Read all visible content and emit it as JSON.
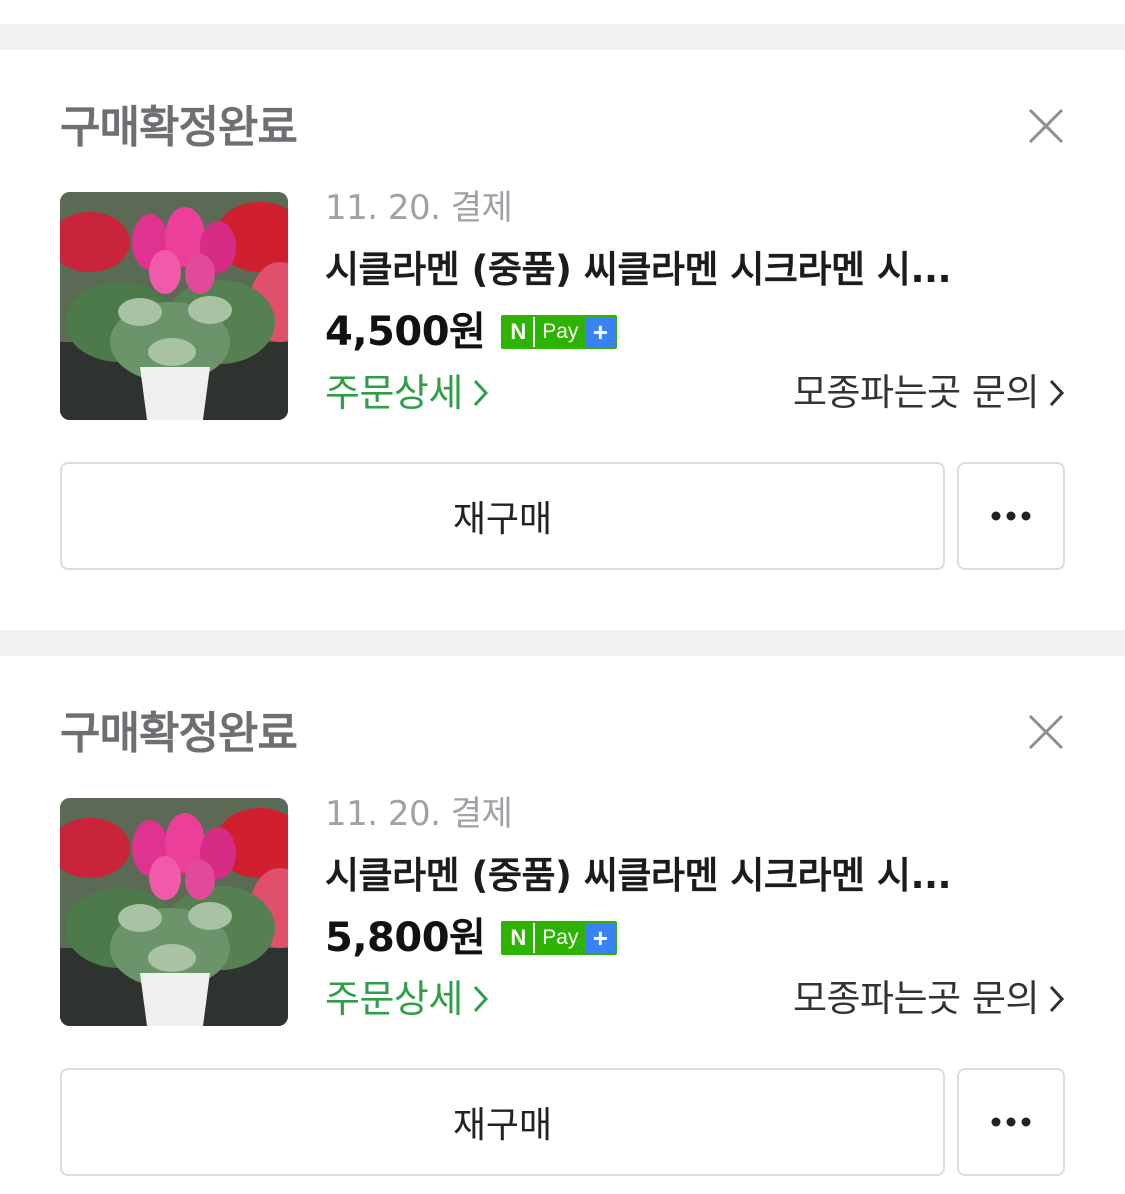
{
  "orders": [
    {
      "status": "구매확정완료",
      "date": "11. 20. 결제",
      "title": "시클라멘 (중품) 씨클라멘 시크라멘 시...",
      "price": "4,500원",
      "npay": {
        "n": "N",
        "pay": "Pay",
        "plus": "+"
      },
      "detail_link": "주문상세",
      "inquiry_link": "모종파는곳 문의",
      "rebuy_button": "재구매",
      "more_button": "•••"
    },
    {
      "status": "구매확정완료",
      "date": "11. 20. 결제",
      "title": "시클라멘 (중품) 씨클라멘 시크라멘 시...",
      "price": "5,800원",
      "npay": {
        "n": "N",
        "pay": "Pay",
        "plus": "+"
      },
      "detail_link": "주문상세",
      "inquiry_link": "모종파는곳 문의",
      "rebuy_button": "재구매",
      "more_button": "•••"
    }
  ],
  "colors": {
    "status_text": "#6e6e73",
    "link_green": "#2f9e48",
    "npay_green": "#2db400",
    "npay_blue": "#3b82f6",
    "divider": "#f1f2f4"
  },
  "icons": [
    "close-icon",
    "chevron-right-icon",
    "more-dots-icon",
    "npay-badge"
  ]
}
